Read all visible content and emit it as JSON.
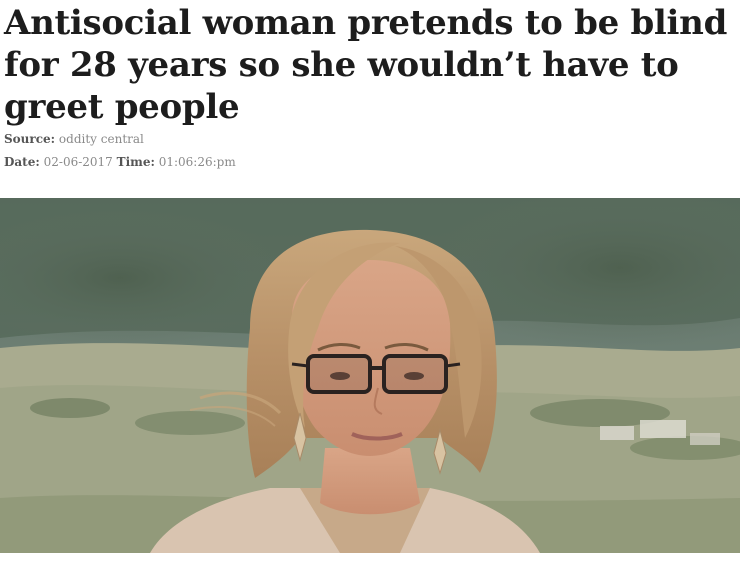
{
  "article": {
    "headline_lines": [
      "Antisocial woman pretends to be blind",
      "for 28 years so she wouldn’t have to",
      "greet people"
    ],
    "source_label": "Source:",
    "source_value": "oddity central",
    "date_label": "Date:",
    "date_value": "02-06-2017",
    "time_label": "Time:",
    "time_value": "01:06:26:pm"
  },
  "photo": {
    "subject": "woman-with-glasses-outdoors"
  }
}
